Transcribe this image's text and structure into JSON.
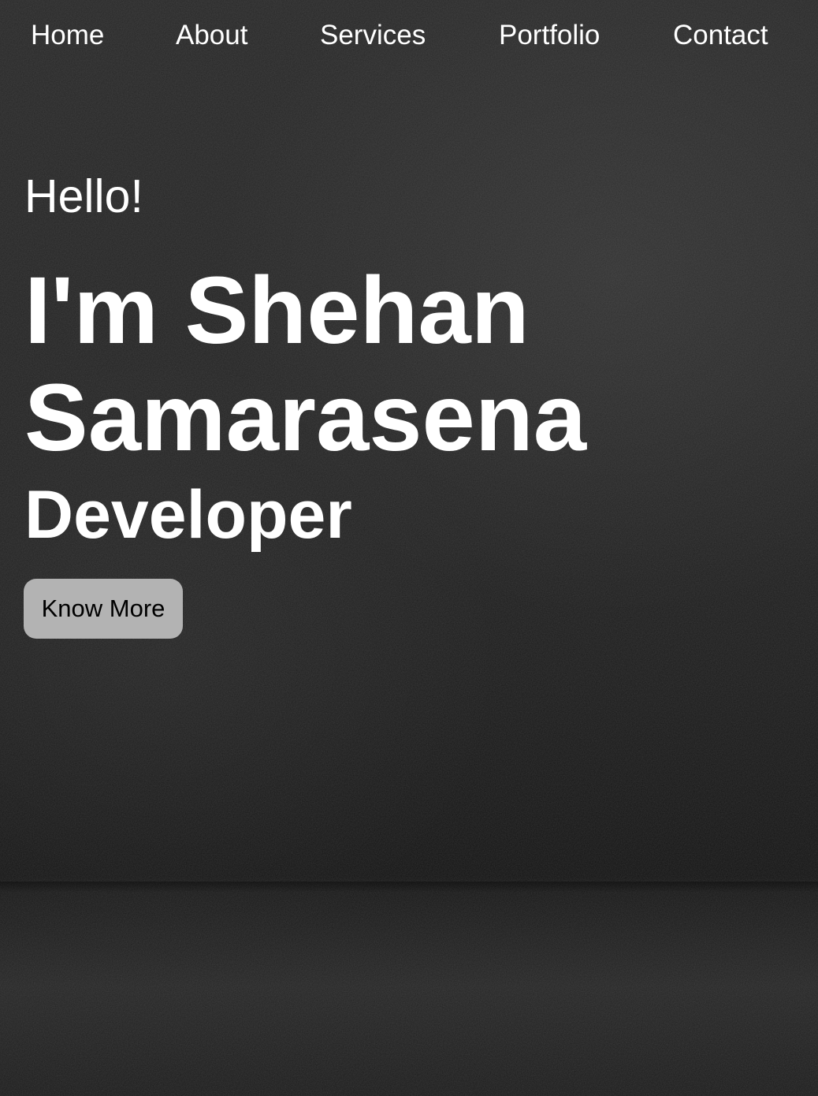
{
  "nav": {
    "items": [
      {
        "label": "Home"
      },
      {
        "label": "About"
      },
      {
        "label": "Services"
      },
      {
        "label": "Portfolio"
      },
      {
        "label": "Contact"
      }
    ]
  },
  "hero": {
    "greeting": "Hello!",
    "name_line_1": "I'm Shehan",
    "name_line_2": "Samarasena",
    "role": "Developer",
    "cta_label": "Know More"
  },
  "colors": {
    "background": "#1c1c1c",
    "text": "#ffffff",
    "button_bg": "#b3b3b3",
    "button_text": "#000000"
  }
}
